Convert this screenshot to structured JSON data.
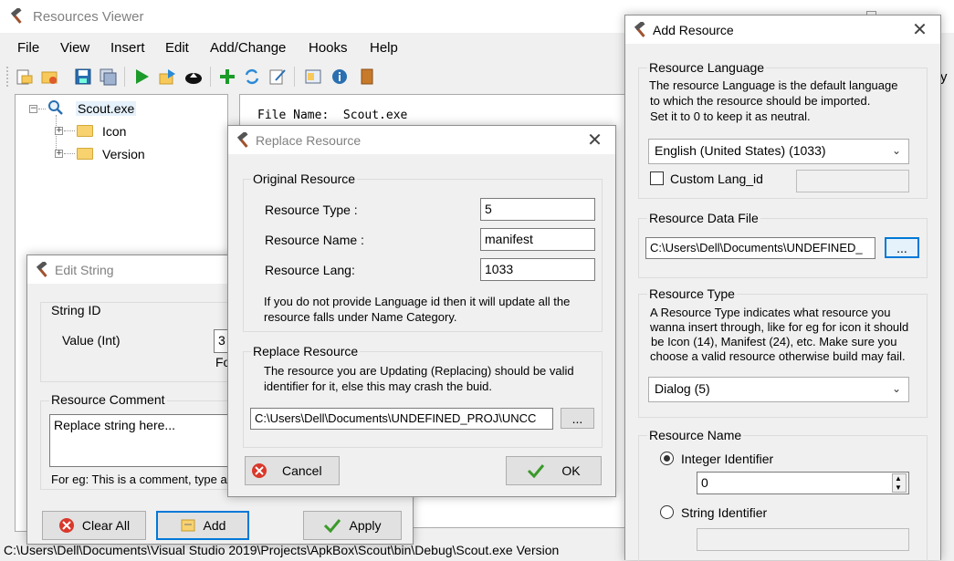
{
  "main_window": {
    "title": "Resources Viewer",
    "menu": [
      "File",
      "View",
      "Insert",
      "Edit",
      "Add/Change",
      "Hooks",
      "Help"
    ],
    "toolbar_icons": [
      "open-icon",
      "open-folder-icon",
      "save-icon",
      "save-as-icon",
      "run-icon",
      "export-icon",
      "upload-icon",
      "add-icon",
      "refresh-icon",
      "edit-icon",
      "properties-icon",
      "info-icon",
      "book-icon"
    ],
    "tree": {
      "root": "Scout.exe",
      "children": [
        "Icon",
        "Version"
      ]
    },
    "info_text": "File Name:  Scout.exe",
    "status_bar": "C:\\Users\\Dell\\Documents\\Visual Studio 2019\\Projects\\ApkBox\\Scout\\bin\\Debug\\Scout.exe  Version",
    "partial_right_text": "y"
  },
  "edit_string": {
    "title": "Edit String",
    "string_id_group": "String ID",
    "value_label": "Value (Int)",
    "value": "3",
    "for_text": "Fo",
    "comment_group": "Resource Comment",
    "comment_value": "Replace string here...",
    "hint": "For eg: This is a comment, type a",
    "buttons": {
      "clear_all": "Clear All",
      "add": "Add",
      "apply": "Apply"
    }
  },
  "replace_resource": {
    "title": "Replace Resource",
    "original_group": "Original Resource",
    "type_label": "Resource Type :",
    "type_value": "5",
    "name_label": "Resource Name :",
    "name_value": "manifest",
    "lang_label": "Resource Lang:",
    "lang_value": "1033",
    "note": "If you do not provide Language id then it will update all the resource falls under Name Category.",
    "replace_group": "Replace Resource",
    "replace_note": "The resource you are Updating (Replacing) should be valid identifier for it, else this may crash the buid.",
    "path_value": "C:\\Users\\Dell\\Documents\\UNDEFINED_PROJ\\UNCC",
    "browse": "...",
    "cancel": "Cancel",
    "ok": "OK"
  },
  "add_resource": {
    "title": "Add Resource",
    "lang_group": "Resource Language",
    "lang_desc": [
      "The resource Language is the default language",
      "to which the resource should be imported.",
      "Set it to 0 to keep it as neutral."
    ],
    "lang_select": "English (United States) (1033)",
    "custom_lang_label": "Custom Lang_id",
    "custom_lang_value": "",
    "data_group": "Resource Data File",
    "data_path": "C:\\Users\\Dell\\Documents\\UNDEFINED_",
    "browse": "...",
    "type_group": "Resource Type",
    "type_desc": [
      "A Resource Type indicates what resource you",
      "wanna insert through, like for eg for icon it should",
      "be Icon (14), Manifest (24), etc. Make sure you",
      "choose a valid resource otherwise build may fail."
    ],
    "type_select": "Dialog (5)",
    "name_group": "Resource Name",
    "integer_label": "Integer Identifier",
    "integer_value": "0",
    "string_label": "String Identifier",
    "string_value": ""
  },
  "colors": {
    "accent": "#0078d7",
    "window_bg": "#f0f0f0",
    "title_bg": "#ffffff"
  }
}
